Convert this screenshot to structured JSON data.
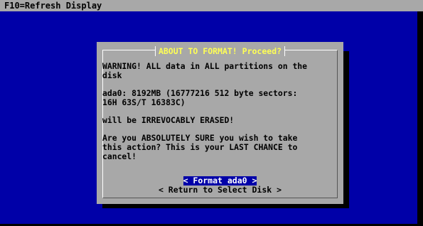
{
  "top_bar": {
    "text": "F10=Refresh Display"
  },
  "dialog": {
    "title": "ABOUT TO FORMAT! Proceed?",
    "lines": [
      "WARNING! ALL data in ALL partitions on the\ndisk",
      "ada0: 8192MB (16777216 512 byte sectors:\n16H 63S/T 16383C)",
      "will be IRREVOCABLY ERASED!",
      "Are you ABSOLUTELY SURE you wish to take\nthis action? This is your LAST CHANCE to\ncancel!"
    ],
    "buttons": {
      "format": "< Format ada0 >",
      "return": "< Return to Select Disk >"
    }
  },
  "colors": {
    "background": "#0000a8",
    "dialog": "#a8a8a8",
    "title": "#ffff55",
    "selected": "#0000a8"
  }
}
